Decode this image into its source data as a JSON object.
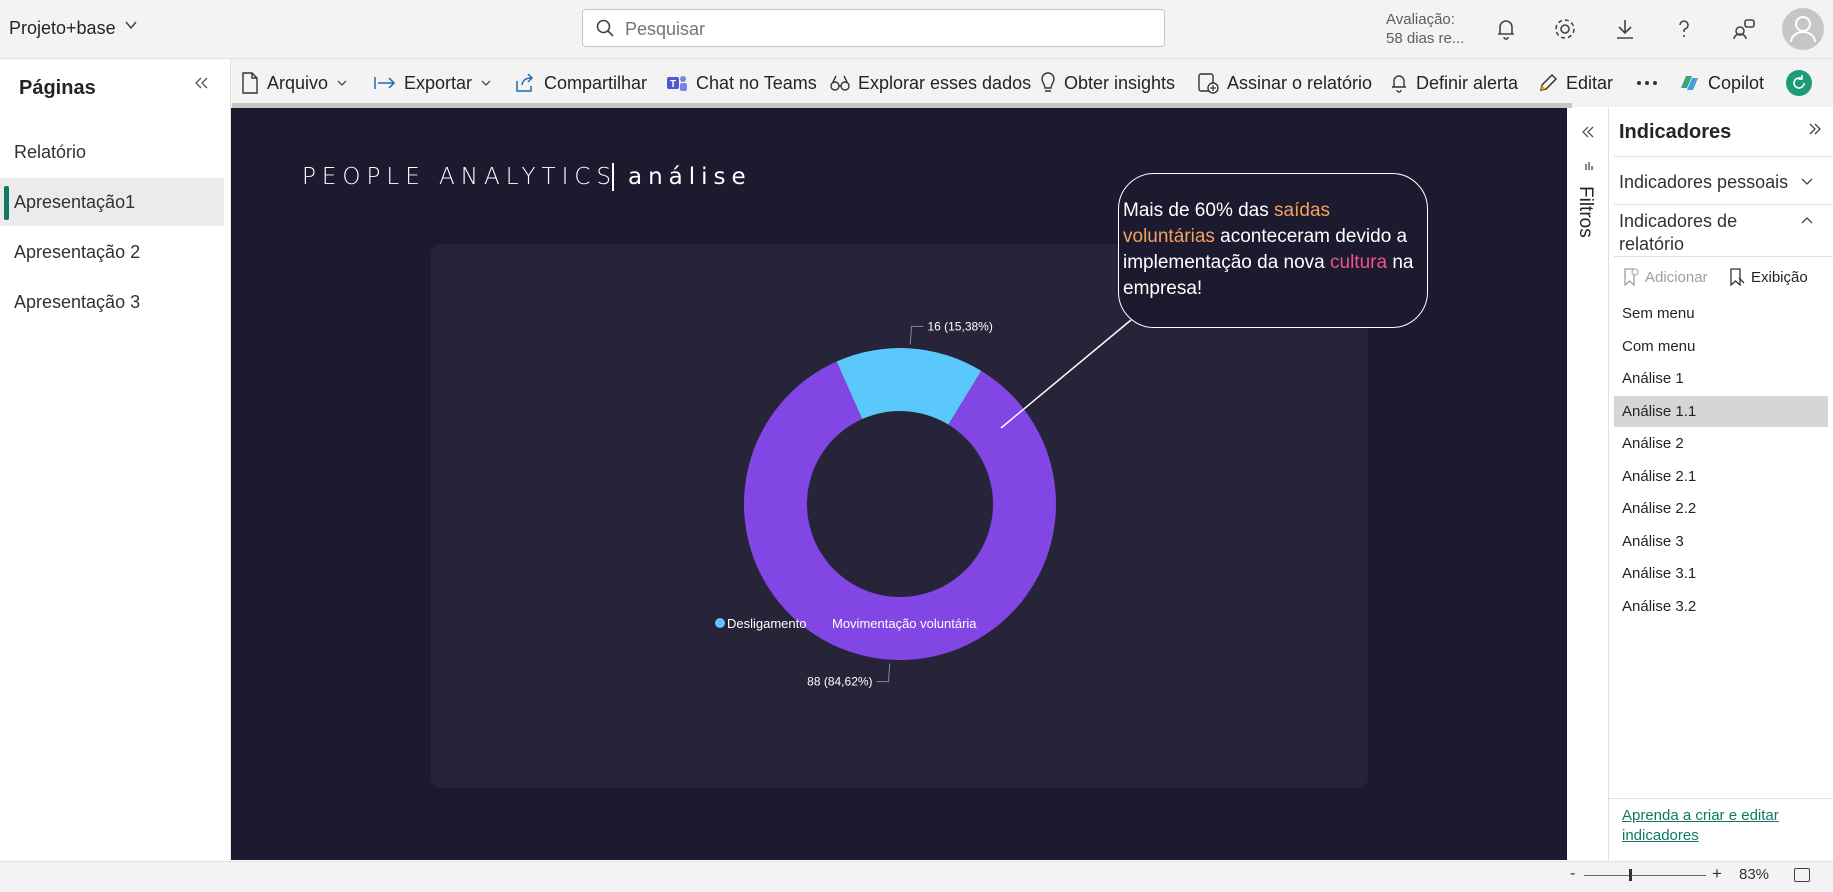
{
  "workspace": {
    "name": "Projeto+base"
  },
  "search": {
    "placeholder": "Pesquisar"
  },
  "trial": {
    "line1": "Avaliação:",
    "line2": "58 dias re..."
  },
  "commands": [
    {
      "label": "Arquivo",
      "icon": "file-icon"
    },
    {
      "label": "Exportar",
      "icon": "export-icon"
    },
    {
      "label": "Compartilhar",
      "icon": "share-icon"
    },
    {
      "label": "Chat no Teams",
      "icon": "teams-icon"
    },
    {
      "label": "Explorar esses dados",
      "icon": "binoculars-icon"
    },
    {
      "label": "Obter insights",
      "icon": "lightbulb-icon"
    },
    {
      "label": "Assinar o relatório",
      "icon": "subscribe-icon"
    },
    {
      "label": "Definir alerta",
      "icon": "bell-icon"
    },
    {
      "label": "Editar",
      "icon": "pencil-icon"
    },
    {
      "label": "Copilot",
      "icon": "copilot-icon"
    }
  ],
  "pages_panel": {
    "title": "Páginas",
    "items": [
      {
        "label": "Relatório",
        "active": false
      },
      {
        "label": "Apresentação1",
        "active": true
      },
      {
        "label": "Apresentação 2",
        "active": false
      },
      {
        "label": "Apresentação 3",
        "active": false
      }
    ]
  },
  "report": {
    "title": "PEOPLE ANALYTICS",
    "subtitle": "análise",
    "callout": {
      "part1": "Mais de 60% das ",
      "highlight1": "saídas voluntárias",
      "part2": " aconteceram devido a implementação da nova ",
      "highlight2": "cultura",
      "part3": " na empresa!"
    }
  },
  "chart_data": {
    "type": "pie",
    "donut": true,
    "categories": [
      "Desligamento",
      "Movimentação voluntária"
    ],
    "values": [
      16,
      88
    ],
    "data_labels": [
      "16 (15,38%)",
      "88 (84,62%)"
    ],
    "colors": [
      "#5bc8fb",
      "#8246e5"
    ],
    "legend": "bottom-center"
  },
  "filters": {
    "label": "Filtros"
  },
  "bookmarks": {
    "title": "Indicadores",
    "section_personal": "Indicadores pessoais",
    "section_report": "Indicadores de relatório",
    "add_label": "Adicionar",
    "view_label": "Exibição",
    "items": [
      "Sem menu",
      "Com menu",
      "Análise 1",
      "Análise 1.1",
      "Análise 2",
      "Análise 2.1",
      "Análise 2.2",
      "Análise 3",
      "Análise 3.1",
      "Análise 3.2"
    ],
    "active_index": 3,
    "learn_link": "Aprenda a criar e editar indicadores"
  },
  "status": {
    "zoom": "83%",
    "zoom_level": 0.38
  }
}
